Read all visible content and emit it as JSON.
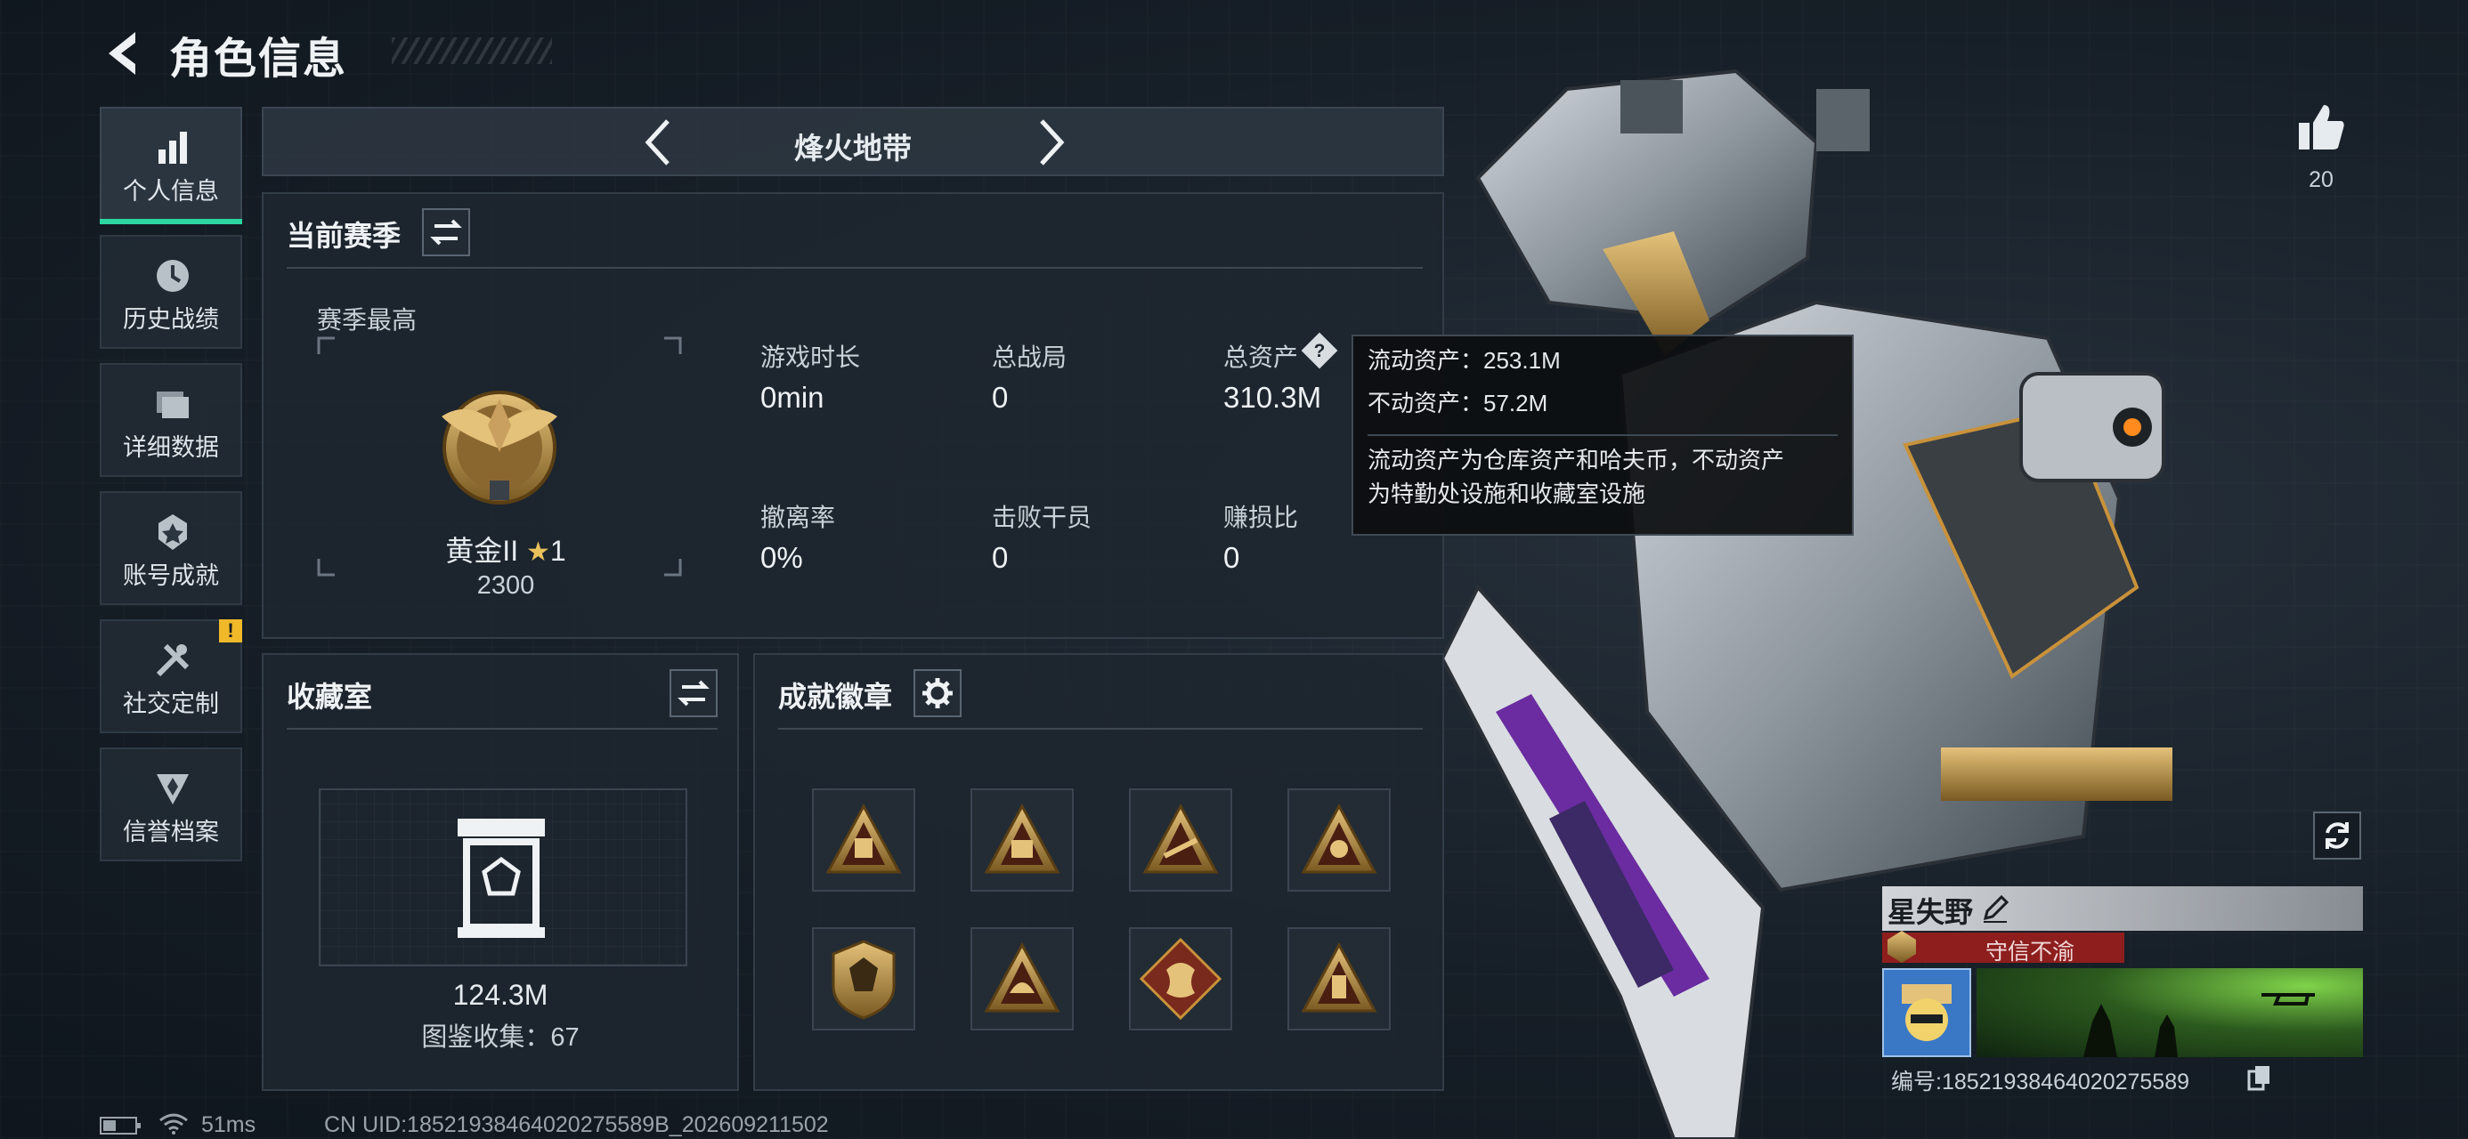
{
  "header": {
    "title": "角色信息"
  },
  "sidebar": {
    "items": [
      {
        "label": "个人信息",
        "icon": "bar-chart-icon",
        "active": true
      },
      {
        "label": "历史战绩",
        "icon": "clock-icon"
      },
      {
        "label": "详细数据",
        "icon": "folder-icon"
      },
      {
        "label": "账号成就",
        "icon": "medal-icon"
      },
      {
        "label": "社交定制",
        "icon": "tools-icon",
        "alert": "!"
      },
      {
        "label": "信誉档案",
        "icon": "shield-icon"
      }
    ]
  },
  "mode": {
    "name": "烽火地带"
  },
  "season": {
    "title": "当前赛季",
    "best_label": "赛季最高",
    "rank": "黄金II",
    "rank_stars": "1",
    "rank_score": "2300",
    "stats": [
      {
        "label": "游戏时长",
        "value": "0min"
      },
      {
        "label": "总战局",
        "value": "0"
      },
      {
        "label": "总资产",
        "value": "310.3M"
      },
      {
        "label": "撤离率",
        "value": "0%"
      },
      {
        "label": "击败干员",
        "value": "0"
      },
      {
        "label": "赚损比",
        "value": "0"
      }
    ]
  },
  "tooltip": {
    "line1": "流动资产：253.1M",
    "line2": "不动资产：57.2M",
    "desc1": "流动资产为仓库资产和哈夫币，不动资产",
    "desc2": "为特勤处设施和收藏室设施"
  },
  "collection": {
    "title": "收藏室",
    "value": "124.3M",
    "catalog": "图鉴收集：67"
  },
  "achievements": {
    "title": "成就徽章"
  },
  "likes": {
    "count": "20"
  },
  "player": {
    "name": "星失野",
    "title": "守信不渝",
    "id": "编号:18521938464020275589"
  },
  "status": {
    "ping": "51ms",
    "uid": "CN UID:18521938464020275589B_202609211502"
  },
  "colors": {
    "accent": "#2bd6a0",
    "gold": "#c9923a",
    "alert": "#f0b92a",
    "title_red": "#8e1e1e"
  }
}
